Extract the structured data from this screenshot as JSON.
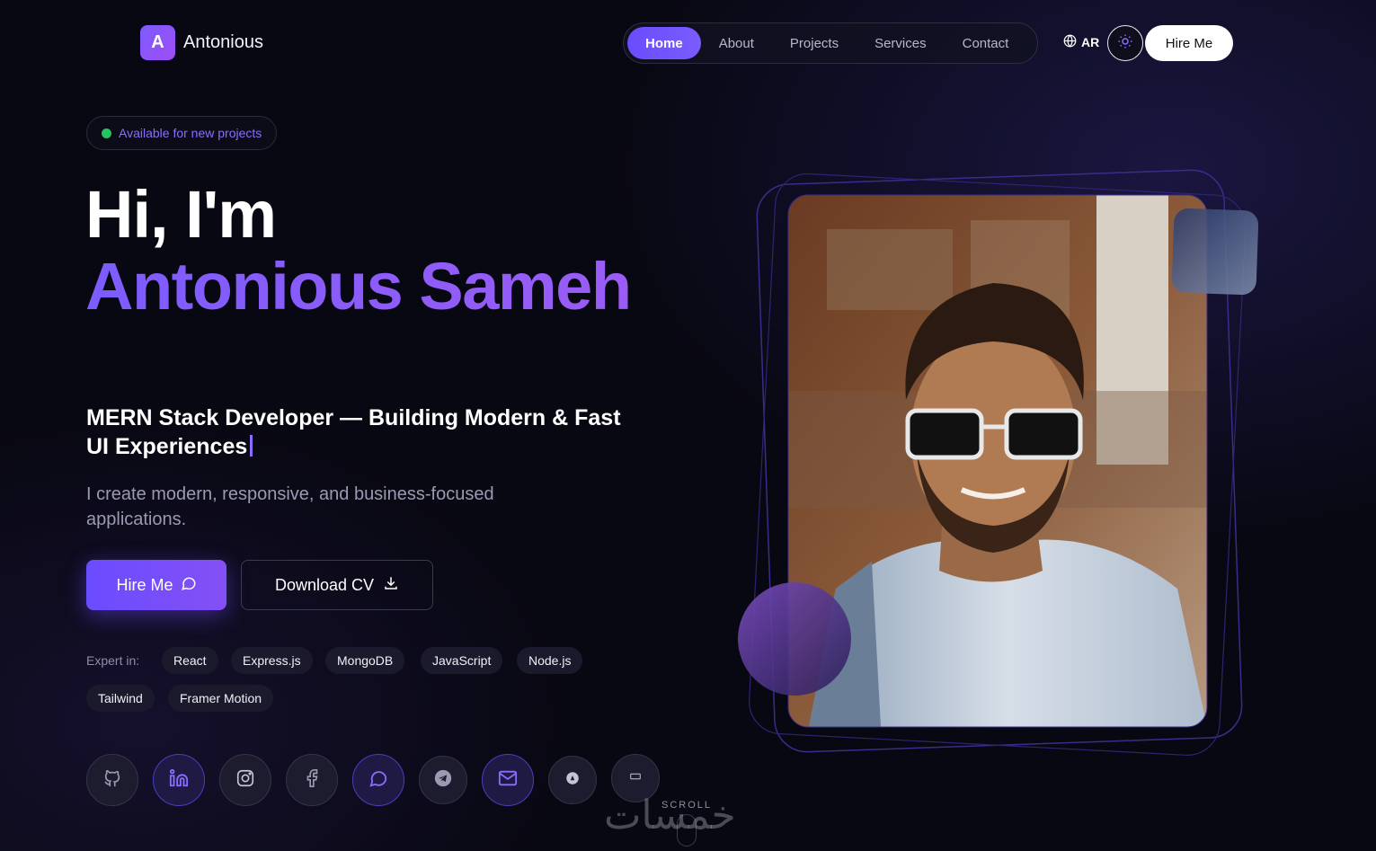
{
  "brand": {
    "logo_letter": "A",
    "name": "Antonious"
  },
  "nav": {
    "items": [
      "Home",
      "About",
      "Projects",
      "Services",
      "Contact"
    ],
    "active": "Home"
  },
  "header": {
    "lang_label": "AR",
    "hire_label": "Hire Me"
  },
  "hero": {
    "badge": "Available for new projects",
    "greeting": "Hi, I'm",
    "name": "Antonious Sameh",
    "tagline": "MERN Stack Developer — Building Modern & Fast UI Experiences",
    "description": "I create modern, responsive, and business-focused applications.",
    "hire_button": "Hire Me",
    "cv_button": "Download CV",
    "expert_label": "Expert in:",
    "skills": [
      "React",
      "Express.js",
      "MongoDB",
      "JavaScript",
      "Node.js",
      "Tailwind",
      "Framer Motion"
    ]
  },
  "social_icons": [
    "github-icon",
    "linkedin-icon",
    "instagram-icon",
    "facebook-icon",
    "whatsapp-icon",
    "telegram-icon",
    "mail-icon",
    "khamsat-icon",
    "mostaql-icon"
  ],
  "scroll_label": "SCROLL",
  "watermark": "خمسات",
  "colors": {
    "accent": "#7c5cff",
    "available": "#22c55e",
    "background": "#080812"
  }
}
